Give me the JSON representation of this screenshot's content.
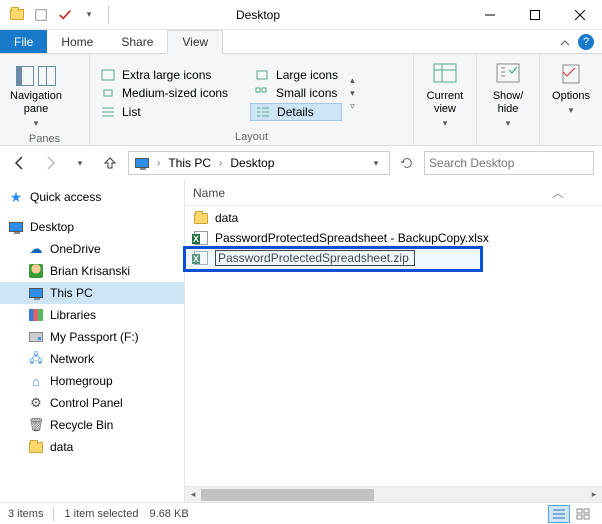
{
  "window": {
    "title": "Desktop"
  },
  "tabs": {
    "file": "File",
    "home": "Home",
    "share": "Share",
    "view": "View"
  },
  "ribbon": {
    "panes": {
      "navpane": "Navigation\npane",
      "group": "Panes"
    },
    "layout": {
      "extra_large": "Extra large icons",
      "large": "Large icons",
      "medium": "Medium-sized icons",
      "small": "Small icons",
      "list": "List",
      "details": "Details",
      "group": "Layout"
    },
    "currentview": {
      "current": "Current\nview"
    },
    "showhide": {
      "showhide": "Show/\nhide"
    },
    "options": {
      "options": "Options"
    }
  },
  "breadcrumbs": {
    "thispc": "This PC",
    "desktop": "Desktop"
  },
  "search": {
    "placeholder": "Search Desktop"
  },
  "tree": {
    "quick_access": "Quick access",
    "desktop": "Desktop",
    "onedrive": "OneDrive",
    "user": "Brian Krisanski",
    "thispc": "This PC",
    "libraries": "Libraries",
    "mypassport": "My Passport (F:)",
    "network": "Network",
    "homegroup": "Homegroup",
    "controlpanel": "Control Panel",
    "recyclebin": "Recycle Bin",
    "data": "data"
  },
  "columns": {
    "name": "Name"
  },
  "files": [
    {
      "name": "data",
      "type": "folder"
    },
    {
      "name": "PasswordProtectedSpreadsheet - BackupCopy.xlsx",
      "type": "xlsx"
    },
    {
      "name": "PasswordProtectedSpreadsheet.zip",
      "type": "xlsx",
      "editing": true
    }
  ],
  "status": {
    "items": "3 items",
    "selected": "1 item selected",
    "size": "9.68 KB"
  }
}
